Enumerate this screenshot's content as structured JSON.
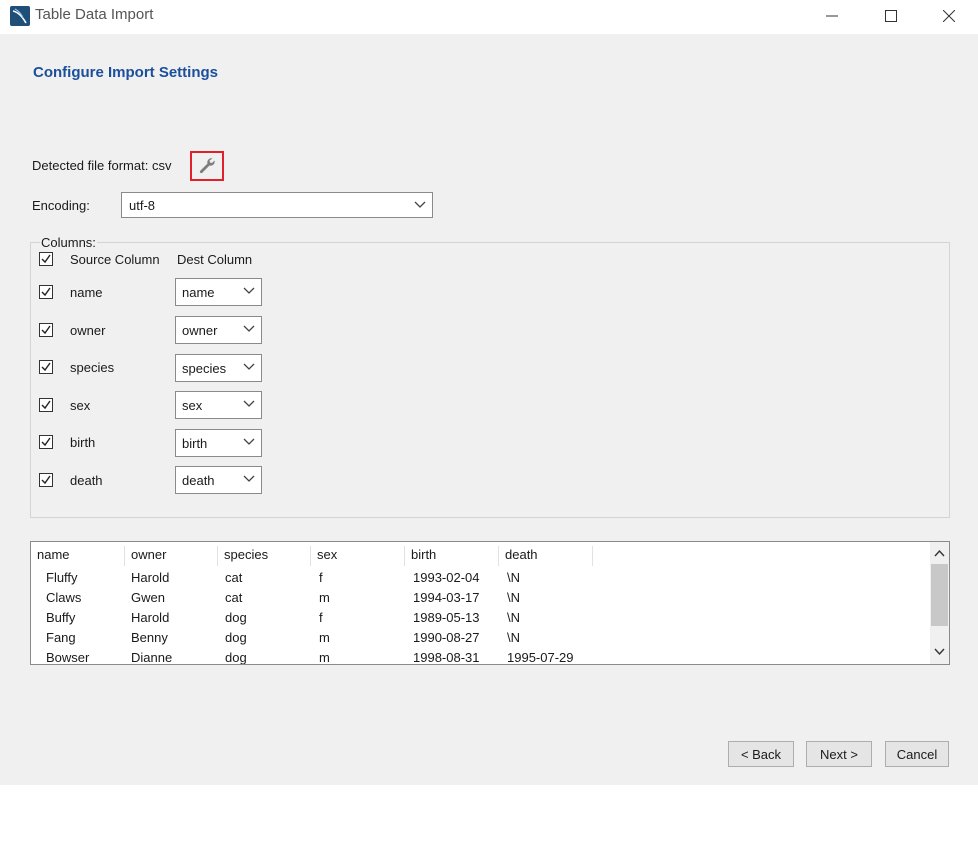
{
  "window": {
    "title": "Table Data Import",
    "controls": [
      "minimize-icon",
      "maximize-icon",
      "close-icon"
    ]
  },
  "page": {
    "heading": "Configure Import Settings",
    "detected_format_label": "Detected file format: csv",
    "encoding_label": "Encoding:",
    "encoding_value": "utf-8"
  },
  "columns": {
    "group_label": "Columns:",
    "header_source": "Source Column",
    "header_dest": "Dest Column",
    "rows": [
      {
        "source": "name",
        "dest": "name",
        "checked": true
      },
      {
        "source": "owner",
        "dest": "owner",
        "checked": true
      },
      {
        "source": "species",
        "dest": "species",
        "checked": true
      },
      {
        "source": "sex",
        "dest": "sex",
        "checked": true
      },
      {
        "source": "birth",
        "dest": "birth",
        "checked": true
      },
      {
        "source": "death",
        "dest": "death",
        "checked": true
      }
    ]
  },
  "preview": {
    "headers": [
      "name",
      "owner",
      "species",
      "sex",
      "birth",
      "death"
    ],
    "rows": [
      [
        "Fluffy",
        "Harold",
        "cat",
        "f",
        "1993-02-04",
        "\\N"
      ],
      [
        "Claws",
        "Gwen",
        "cat",
        "m",
        "1994-03-17",
        "\\N"
      ],
      [
        "Buffy",
        "Harold",
        "dog",
        "f",
        "1989-05-13",
        "\\N"
      ],
      [
        "Fang",
        "Benny",
        "dog",
        "m",
        "1990-08-27",
        "\\N"
      ],
      [
        "Bowser",
        "Dianne",
        "dog",
        "m",
        "1998-08-31",
        "1995-07-29"
      ]
    ]
  },
  "buttons": {
    "back": "< Back",
    "next": "Next >",
    "cancel": "Cancel"
  },
  "colors": {
    "heading": "#1b4f9c",
    "highlight_border": "#e0202a",
    "dialog_bg": "#f0f0f0"
  }
}
